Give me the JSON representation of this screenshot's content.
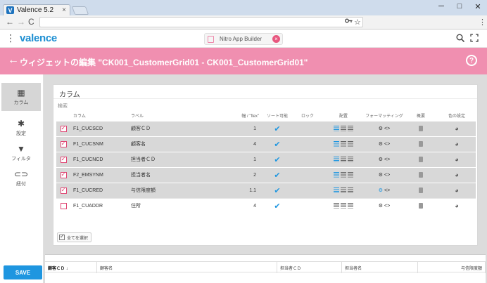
{
  "browser": {
    "tab_title": "Valence 5.2",
    "tab_logo": "V",
    "tab_close": "×",
    "win_min": "─",
    "win_max": "□",
    "win_close": "✕",
    "nav_back": "←",
    "nav_forward": "→",
    "nav_reload": "C",
    "icon_key": "key-icon",
    "icon_star": "☆",
    "icon_menu": "⋮"
  },
  "app": {
    "brand": "valence",
    "kebab": "⋮",
    "nitro_label": "Nitro App Builder",
    "nitro_close": "×",
    "search_icon": "🔍",
    "expand_icon": "⤢"
  },
  "banner": {
    "back": "←",
    "title": "ウィジェットの編集 \"CK001_CustomerGrid01 - CK001_CustomerGrid01\"",
    "help": "?"
  },
  "sidebar": {
    "items": [
      {
        "icon": "▦",
        "label": "カラム"
      },
      {
        "icon": "✱",
        "label": "設定"
      },
      {
        "icon": "▼",
        "label": "フィルタ"
      },
      {
        "icon": "⊂⊃",
        "label": "紐付"
      }
    ],
    "save": "SAVE"
  },
  "card": {
    "title": "カラム",
    "search_placeholder": "検索",
    "headers": {
      "column": "カラム",
      "label": "ラベル",
      "width": "幅 / \"flex\"",
      "sortable": "ソート可能",
      "lock": "ロック",
      "align": "配置",
      "format": "フォーマッティング",
      "summary": "概要",
      "color": "色の設定"
    },
    "rows": [
      {
        "checked": true,
        "column": "F1_CUCSCD",
        "label": "顧客ＣＤ",
        "width": "1",
        "sortable": "✔",
        "format_icon": "⚙",
        "format_code": "<>"
      },
      {
        "checked": true,
        "column": "F1_CUCSNM",
        "label": "顧客名",
        "width": "4",
        "sortable": "✔",
        "format_icon": "⚙",
        "format_code": "<>"
      },
      {
        "checked": true,
        "column": "F1_CUCNCD",
        "label": "担当者ＣＤ",
        "width": "1",
        "sortable": "✔",
        "format_icon": "⚙",
        "format_code": "<>"
      },
      {
        "checked": true,
        "column": "F2_EMSYNM",
        "label": "担当者名",
        "width": "2",
        "sortable": "✔",
        "format_icon": "⚙",
        "format_code": "<>"
      },
      {
        "checked": true,
        "column": "F1_CUCRED",
        "label": "与信限度額",
        "width": "1.1",
        "sortable": "✔",
        "format_icon": "⚙",
        "format_code": "<>"
      },
      {
        "checked": false,
        "column": "F1_CUADDR",
        "label": "住所",
        "width": "4",
        "sortable": "✔",
        "format_icon": "⚙",
        "format_code": "<>"
      }
    ],
    "select_all": "全てを選択",
    "color_icon": "◕"
  },
  "preview": {
    "columns": [
      "顧客ＣＤ ↓",
      "顧客名",
      "担当者ＣＤ",
      "担当者名",
      "与信限度額"
    ]
  },
  "colors": {
    "banner": "#f08fb0",
    "accent": "#1e96e0",
    "checkbox": "#e04a76"
  }
}
